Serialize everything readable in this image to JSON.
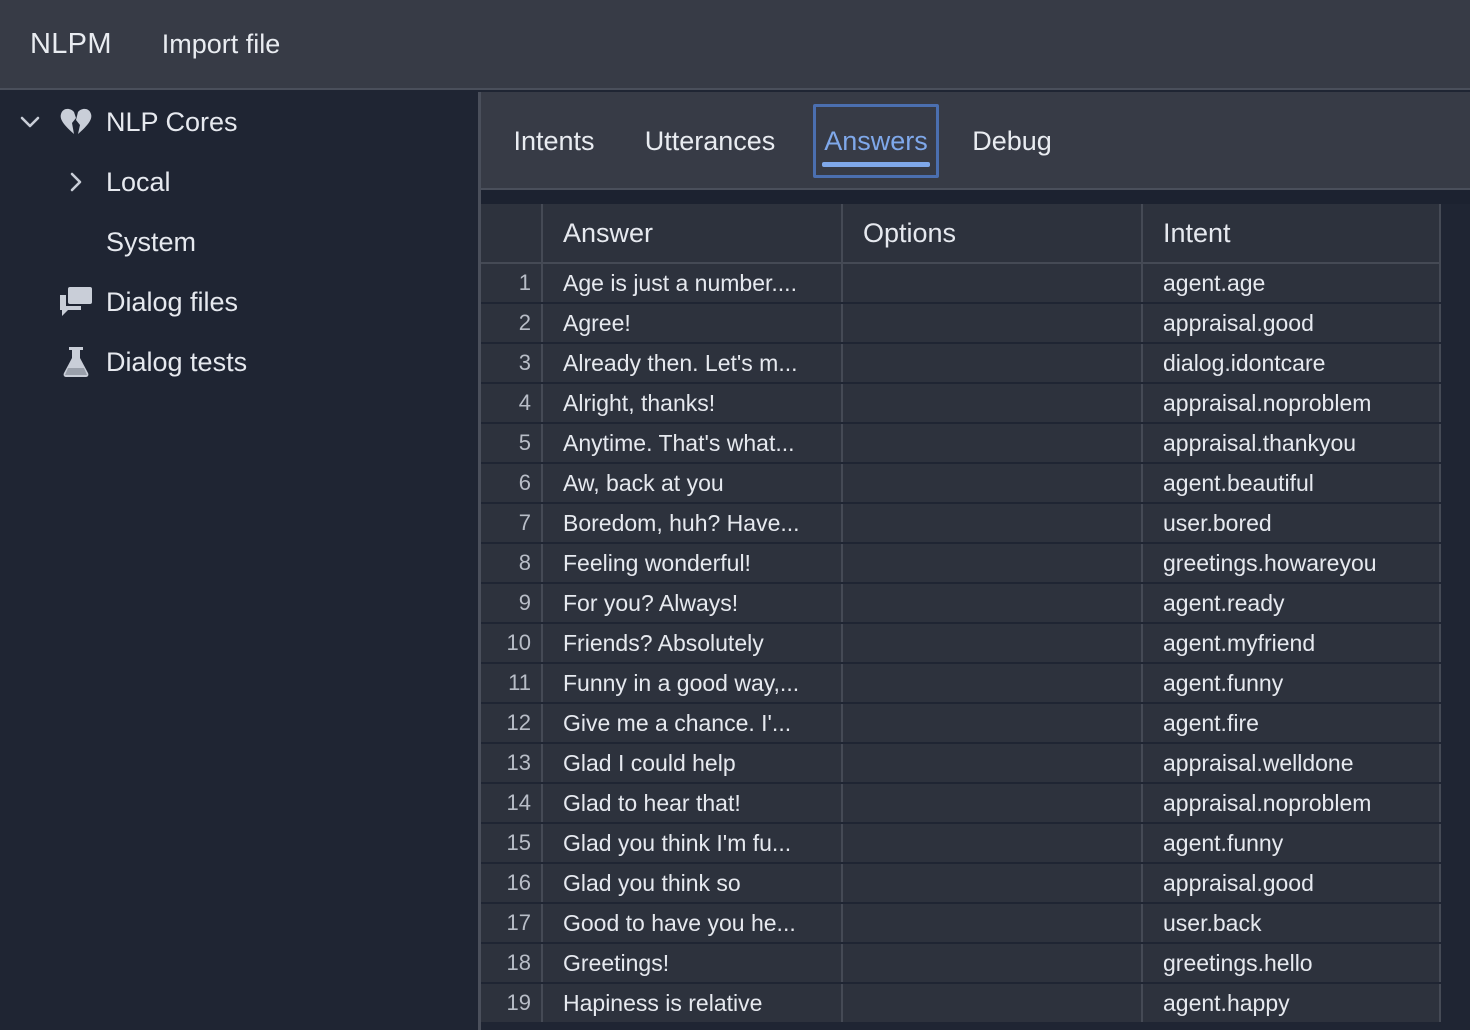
{
  "app": {
    "title": "NLPM",
    "menu_import": "Import file"
  },
  "sidebar": {
    "items": [
      {
        "label": "NLP Cores",
        "icon": "broken-heart-icon",
        "expanded": true
      },
      {
        "label": "Local",
        "icon": "chevron-right-icon"
      },
      {
        "label": "System"
      },
      {
        "label": "Dialog files",
        "icon": "chat-bubbles-icon"
      },
      {
        "label": "Dialog tests",
        "icon": "flask-icon"
      }
    ]
  },
  "tabs": {
    "items": [
      {
        "label": "Intents"
      },
      {
        "label": "Utterances"
      },
      {
        "label": "Answers",
        "active": true
      },
      {
        "label": "Debug"
      }
    ]
  },
  "table": {
    "columns": [
      "Answer",
      "Options",
      "Intent"
    ],
    "rows": [
      {
        "n": "1",
        "answer": "Age is just a number....",
        "options": "",
        "intent": "agent.age"
      },
      {
        "n": "2",
        "answer": "Agree!",
        "options": "",
        "intent": "appraisal.good"
      },
      {
        "n": "3",
        "answer": "Already then. Let's m...",
        "options": "",
        "intent": "dialog.idontcare"
      },
      {
        "n": "4",
        "answer": "Alright, thanks!",
        "options": "",
        "intent": "appraisal.noproblem"
      },
      {
        "n": "5",
        "answer": "Anytime. That's what...",
        "options": "",
        "intent": "appraisal.thankyou"
      },
      {
        "n": "6",
        "answer": "Aw, back at you",
        "options": "",
        "intent": "agent.beautiful"
      },
      {
        "n": "7",
        "answer": "Boredom, huh? Have...",
        "options": "",
        "intent": "user.bored"
      },
      {
        "n": "8",
        "answer": "Feeling wonderful!",
        "options": "",
        "intent": "greetings.howareyou"
      },
      {
        "n": "9",
        "answer": "For you? Always!",
        "options": "",
        "intent": "agent.ready"
      },
      {
        "n": "10",
        "answer": "Friends? Absolutely",
        "options": "",
        "intent": "agent.myfriend"
      },
      {
        "n": "11",
        "answer": "Funny in a good way,...",
        "options": "",
        "intent": "agent.funny"
      },
      {
        "n": "12",
        "answer": "Give me a chance. I'...",
        "options": "",
        "intent": "agent.fire"
      },
      {
        "n": "13",
        "answer": "Glad I could help",
        "options": "",
        "intent": "appraisal.welldone"
      },
      {
        "n": "14",
        "answer": "Glad to hear that!",
        "options": "",
        "intent": "appraisal.noproblem"
      },
      {
        "n": "15",
        "answer": "Glad you think I'm fu...",
        "options": "",
        "intent": "agent.funny"
      },
      {
        "n": "16",
        "answer": "Glad you think so",
        "options": "",
        "intent": "appraisal.good"
      },
      {
        "n": "17",
        "answer": "Good to have you he...",
        "options": "",
        "intent": "user.back"
      },
      {
        "n": "18",
        "answer": "Greetings!",
        "options": "",
        "intent": "greetings.hello"
      },
      {
        "n": "19",
        "answer": "Hapiness is relative",
        "options": "",
        "intent": "agent.happy"
      }
    ]
  },
  "colors": {
    "accent": "#7fa8ea",
    "topbar": "#373b46",
    "sidebar": "#1f2533",
    "row": "#2d323d"
  }
}
